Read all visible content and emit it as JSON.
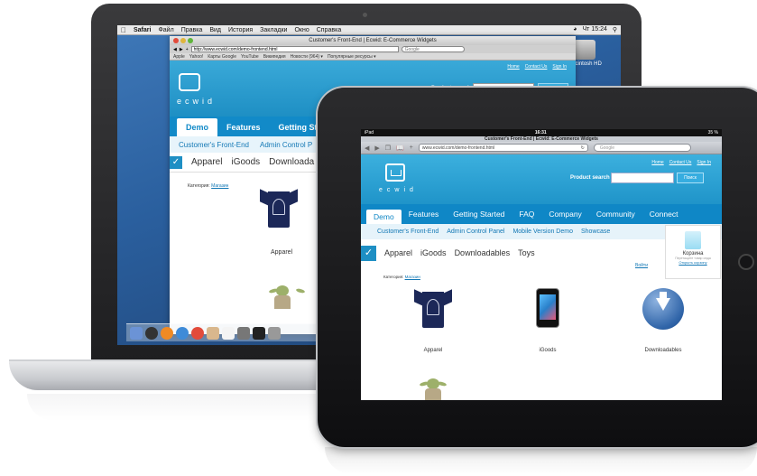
{
  "macbook": {
    "menubar": {
      "app": "Safari",
      "items": [
        "Файл",
        "Правка",
        "Вид",
        "История",
        "Закладки",
        "Окно",
        "Справка"
      ],
      "clock": "Чт 15:24"
    },
    "window_title": "Customer's Front-End | Ecwid: E-Commerce Widgets",
    "url": "http://www.ecwid.com/demo-frontend.html",
    "search_placeholder": "Google",
    "bookmarks": [
      "Apple",
      "Yahoo!",
      "Карты Google",
      "YouTube",
      "Википедия",
      "Новости (964) ▾",
      "Популярные ресурсы ▾"
    ],
    "desktop_icon_label": "Macintosh HD",
    "store": {
      "header_links": [
        "Home",
        "Contact Us",
        "Sign In"
      ],
      "logo_text": "ecwid",
      "product_search_label": "Product search",
      "search_button": "Поиск",
      "nav": [
        "Demo",
        "Features",
        "Getting Starte"
      ],
      "subnav": [
        "Customer's Front-End",
        "Admin Control P"
      ],
      "categories": [
        "Apparel",
        "iGoods",
        "Downloada"
      ],
      "breadcrumb_label": "Категория:",
      "breadcrumb_link": "Магазин",
      "product_label": "Apparel"
    }
  },
  "ipad": {
    "status": {
      "left": "iPad",
      "time": "16:31",
      "battery": "35 %"
    },
    "page_title": "Customer's Front-End | Ecwid: E-Commerce Widgets",
    "url": "www.ecwid.com/demo-frontend.html",
    "search_placeholder": "Google",
    "store": {
      "header_links": [
        "Home",
        "Contact Us",
        "Sign In"
      ],
      "logo_text": "ecwid",
      "product_search_label": "Product search",
      "search_button": "Поиск",
      "nav": [
        "Demo",
        "Features",
        "Getting Started",
        "FAQ",
        "Company",
        "Community",
        "Connect"
      ],
      "subnav": [
        "Customer's Front-End",
        "Admin Control Panel",
        "Mobile Version Demo",
        "Showcase"
      ],
      "categories": [
        "Apparel",
        "iGoods",
        "Downloadables",
        "Toys"
      ],
      "login_link": "Войти",
      "cart": {
        "title": "Корзина",
        "note": "Перетащите товар сюда",
        "link": "Открыть корзину"
      },
      "breadcrumb_label": "Категория:",
      "breadcrumb_link": "Магазин",
      "products": [
        "Apparel",
        "iGoods",
        "Downloadables"
      ]
    }
  }
}
